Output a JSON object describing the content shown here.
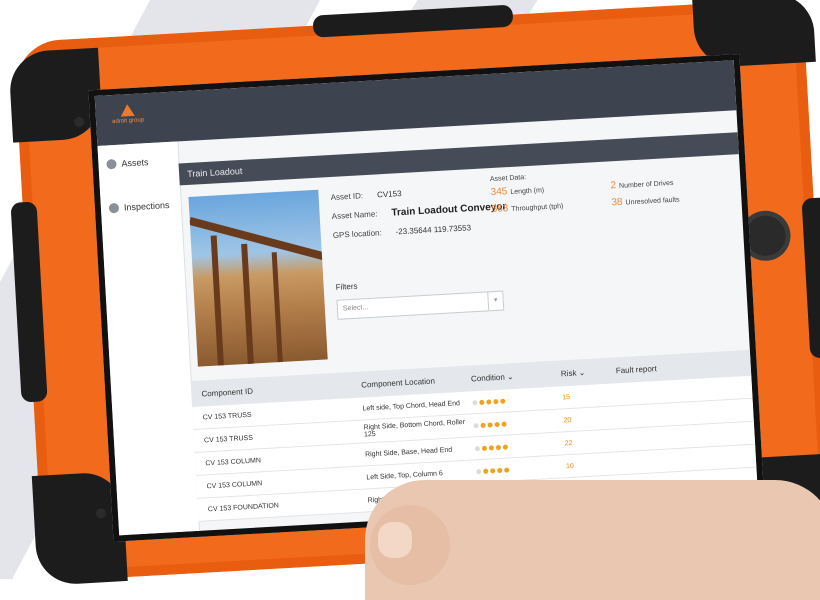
{
  "app": {
    "logo_text": "adroit group"
  },
  "sidebar": {
    "items": [
      {
        "label": "Assets"
      },
      {
        "label": "Inspections"
      }
    ]
  },
  "page": {
    "title": "Train Loadout"
  },
  "asset": {
    "id_label": "Asset ID:",
    "id_value": "CV153",
    "name_label": "Asset Name:",
    "name_value": "Train Loadout Conveyor",
    "gps_label": "GPS location:",
    "gps_value": "-23.35644 119.73553"
  },
  "asset_data": {
    "heading": "Asset Data:",
    "stats": [
      {
        "value": "345",
        "label": "Length (m)"
      },
      {
        "value": "2",
        "label": "Number of Drives"
      },
      {
        "value": "563",
        "label": "Throughput (tph)"
      },
      {
        "value": "38",
        "label": "Unresolved faults"
      }
    ]
  },
  "filters": {
    "label": "Filters",
    "placeholder": "Select..."
  },
  "table": {
    "headers": [
      "Component ID",
      "Component Location",
      "Condition",
      "Risk",
      "Fault report"
    ],
    "rows": [
      {
        "id": "CV 153 TRUSS",
        "location": "Left side, Top Chord, Head End",
        "condition": 4,
        "risk": "15"
      },
      {
        "id": "CV 153 TRUSS",
        "location": "Right Side, Bottom Chord, Roller 125",
        "condition": 4,
        "risk": "20"
      },
      {
        "id": "CV 153 COLUMN",
        "location": "Right Side, Base, Head End",
        "condition": 4,
        "risk": "22"
      },
      {
        "id": "CV 153 COLUMN",
        "location": "Left Side, Top, Column 6",
        "condition": 4,
        "risk": "10"
      },
      {
        "id": "CV 153 FOUNDATION",
        "location": "Right Side, Head End",
        "condition": 3,
        "risk": ""
      }
    ]
  },
  "colors": {
    "case": "#f26a1b",
    "accent": "#f08a3a",
    "header": "#3d4450"
  }
}
